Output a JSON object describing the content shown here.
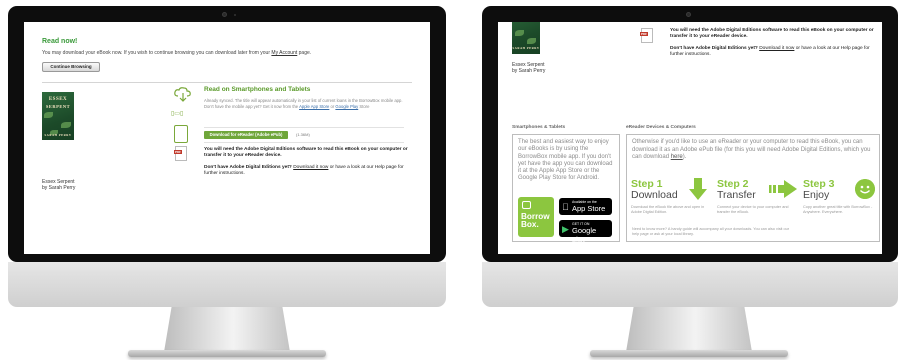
{
  "left_screen": {
    "heading": "Read now!",
    "message_prefix": "You may download your eBook now. If you wish to continue browsing you can download later from your ",
    "message_link": "My Account",
    "message_suffix": " page.",
    "continue_button": "Continue Browsing",
    "book_title": "Essex Serpent",
    "book_author": "by Sarah Perry",
    "cover_title_1": "ESSEX",
    "cover_title_2": "SERPENT",
    "cover_author": "SARAH PERRY",
    "read_heading": "Read on Smartphones and Tablets",
    "read_text_1": "Already synced. The title will appear automatically in your list of current loans in the BorrowBox",
    "read_text_2": "mobile app. Don't have the mobile app yet? Get it now from the ",
    "app_store_link": "Apple App Store",
    "read_text_or": " or ",
    "google_play_link": "Google Play",
    "read_text_3": "Store",
    "download_button": "Download for eReader (Adobe ePub)",
    "file_size": "(1.36M)",
    "note_bold": "You will need the Adobe Digital Editions software to read this eBook on your computer or transfer it to your eReader device.",
    "note2_bold": "Don't have Adobe Digital Editions yet?",
    "note2_link": "Download it now",
    "note2_rest": " or have a look at our Help page for further instructions."
  },
  "right_screen": {
    "note_bold": "You will need the Adobe Digital Editions software to read this eBook on your computer or transfer it to your eReader device.",
    "note2_bold": "Don't have Adobe Digital Editions yet?",
    "note2_link": "Download it now",
    "note2_rest": " or have a look at our Help page for further instructions.",
    "book_title": "Essex Serpent",
    "book_author": "by Sarah Perry",
    "cover_author": "SARAH PERRY",
    "smart_heading": "Smartphones & Tablets",
    "ereader_heading": "eReader Devices & Computers",
    "smart_text": "The best and easiest way to enjoy our eBooks is by using the BorrowBox mobile app. If you don't yet have the app you can download it at the Apple App Store or the Google Play Store for Android.",
    "borrowbox_1": "Borrow",
    "borrowbox_2": "Box.",
    "appstore_small": "Available on the",
    "appstore_big": "App Store",
    "gplay_small": "GET IT ON",
    "gplay_big": "Google play",
    "ereader_text_1": "Otherwise if you'd like to use an eReader or your computer to read this eBook, you can download it as an Adobe ePub file (for this you will need Adobe Digital Editions, which you can download ",
    "ereader_link": "here",
    "ereader_text_2": ").",
    "step1_label": "Step 1",
    "step1_word": "Download",
    "step1_desc": "Download the eBook file above and open in Adobe Digital Edition.",
    "step2_label": "Step 2",
    "step2_word": "Transfer",
    "step2_desc": "Connect your device to your computer and transfer the eBook.",
    "step3_label": "Step 3",
    "step3_word": "Enjoy",
    "step3_desc": "Copy another great title with BorrowBox - Anywhere. Everywhere.",
    "need_more": "Need to know more? A handy guide will accompany all your downloads. You can also visit our help page or ask at your local library."
  },
  "colors": {
    "accent_green": "#8cc63f",
    "heading_green": "#5a9a2a",
    "bezel": "#0d0d0d"
  }
}
